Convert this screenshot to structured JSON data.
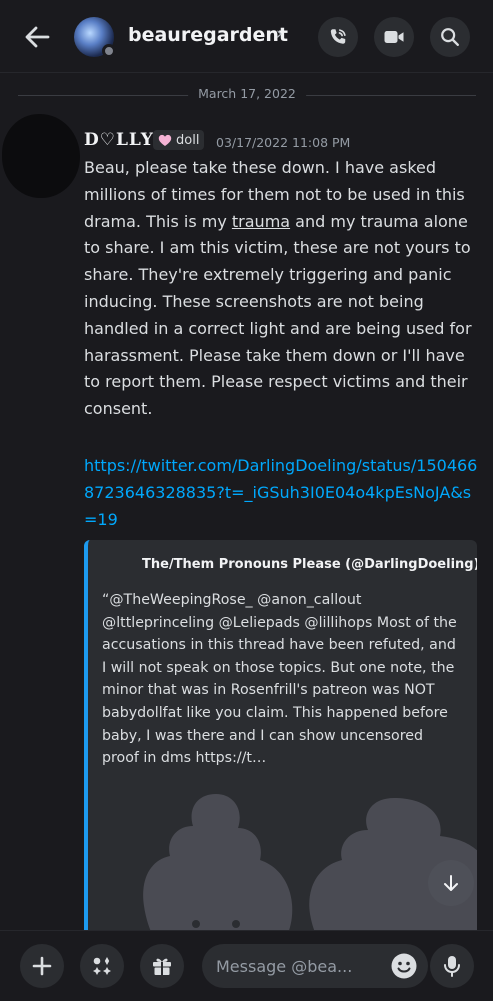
{
  "header": {
    "channel_name": "beauregardent",
    "chevron": "›"
  },
  "date_divider": "March 17, 2022",
  "message": {
    "author": "D♡LLY",
    "tag": "doll",
    "timestamp": "03/17/2022 11:08 PM",
    "body_pre": "Beau, please take these down. I have asked millions of times for them not to be used in this drama. This is my ",
    "body_underlined": "trauma",
    "body_post": " and my trauma alone to share. I am this victim, these are not yours to share. They're extremely triggering and panic inducing. These screenshots are not being handled in a correct light and are being used for harassment. Please take them down or I'll have to report them. Please respect victims and their consent.",
    "link": "https://twitter.com/DarlingDoeling/status/1504668723646328835?t=_iGSuh3I0E04o4kpEsNoJA&s=19"
  },
  "embed": {
    "author": "The/Them Pronouns Please (@DarlingDoeling)",
    "text": "“@TheWeepingRose_ @anon_callout @lttleprinceling @Leliepads @lillihops Most of the accusations in this thread have been refuted, and I will not speak on those topics. But one note, the minor that was in Rosenfrill's patreon was NOT babydollfat like you claim. This happened before baby, I was there and I can show uncensored proof in dms https://t…",
    "accent_color": "#1d9bf0"
  },
  "composer": {
    "placeholder": "Message @bea..."
  },
  "colors": {
    "background": "#1a1a1e",
    "link": "#00a8fc",
    "surface": "#2b2d31"
  }
}
